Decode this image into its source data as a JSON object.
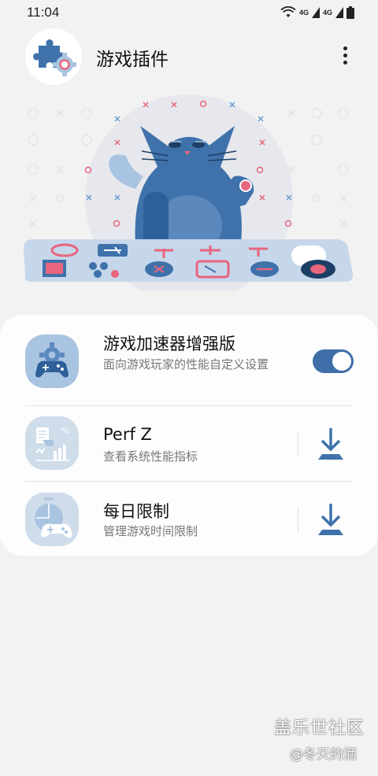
{
  "status_bar": {
    "time": "11:04",
    "network_label_1": "4G",
    "network_label_2": "4G"
  },
  "header": {
    "title": "游戏插件"
  },
  "plugins": [
    {
      "title": "游戏加速器增强版",
      "subtitle": "面向游戏玩家的性能自定义设置",
      "enabled": true
    },
    {
      "title": "Perf Z",
      "subtitle": "查看系统性能指标"
    },
    {
      "title": "每日限制",
      "subtitle": "管理游戏时间限制"
    }
  ],
  "watermark": {
    "main": "盖乐世社区",
    "sub": "@冬天的酒"
  },
  "colors": {
    "accent": "#3e6fa8",
    "icon_bg": "#a9c4e0",
    "pink": "#e8657e",
    "background": "#f2f2f2"
  }
}
